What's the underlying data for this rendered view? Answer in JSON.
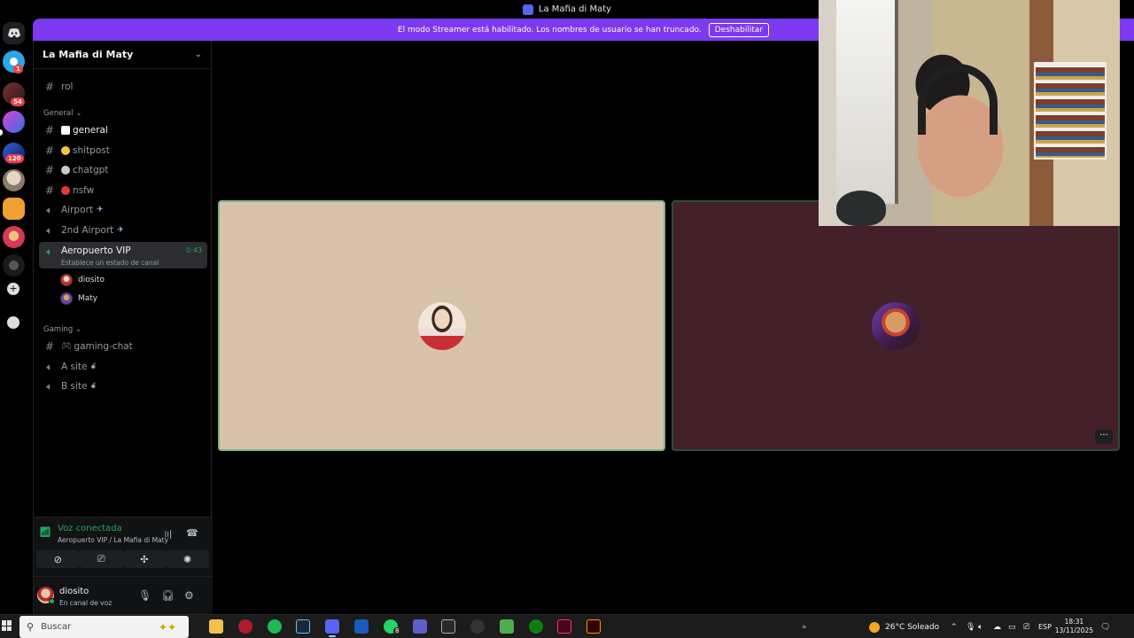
{
  "window": {
    "title": "La Mafia di Maty"
  },
  "banner": {
    "message": "El modo Streamer está habilitado. Los nombres de usuario se han truncado.",
    "button": "Deshabilitar"
  },
  "rail": {
    "badges": [
      "1",
      "54",
      "120"
    ]
  },
  "server": {
    "name": "La Mafia di Maty"
  },
  "channels": {
    "rol": "rol",
    "category_general": "General",
    "general": "general",
    "shitpost": "shitpost",
    "chatgpt": "chatgpt",
    "nsfw": "nsfw",
    "airport": "Airport",
    "airport2": "2nd Airport",
    "vip": "Aeropuerto VIP",
    "vip_timer": "0:43",
    "vip_status": "Establece un estado de canal",
    "voice_users": [
      "diosito",
      "Maty"
    ],
    "category_gaming": "Gaming",
    "gaming_chat": "gaming-chat",
    "a_site": "A site",
    "b_site": "B site"
  },
  "voice_panel": {
    "status": "Voz conectada",
    "location": "Aeropuerto VIP / La Mafia di Maty"
  },
  "user": {
    "name": "diosito",
    "status": "En canal de voz"
  },
  "taskbar": {
    "search_placeholder": "Buscar",
    "weather": "26°C  Soleado",
    "lang": "ESP",
    "time": "18:31",
    "date": "13/11/2025",
    "whatsapp_badge": "8"
  },
  "colors": {
    "accent": "#7c3af0",
    "voice_green": "#23a559",
    "tile1_bg": "#d8c2a9",
    "tile2_bg": "#43202a"
  }
}
